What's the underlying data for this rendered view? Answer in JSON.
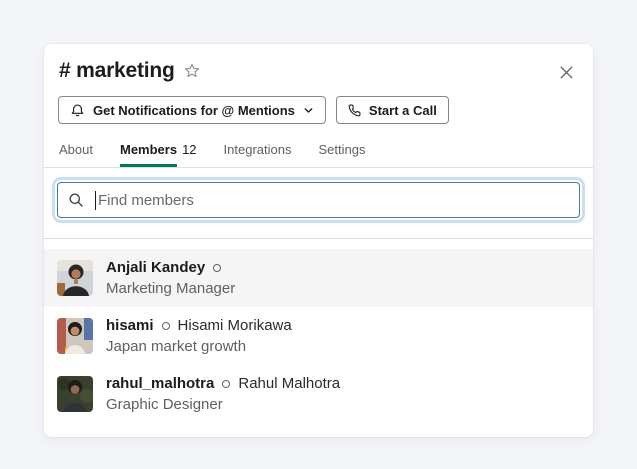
{
  "modal": {
    "title": "# marketing"
  },
  "actions": {
    "notifications_label": "Get Notifications for @ Mentions",
    "start_call_label": "Start a Call"
  },
  "tabs": [
    {
      "label": "About",
      "active": false
    },
    {
      "label": "Members",
      "count": "12",
      "active": true
    },
    {
      "label": "Integrations",
      "active": false
    },
    {
      "label": "Settings",
      "active": false
    }
  ],
  "search": {
    "placeholder": "Find members",
    "value": ""
  },
  "members": [
    {
      "display_name": "Anjali Kandey",
      "full_name": "",
      "subtitle": "Marketing Manager",
      "presence": "offline",
      "highlighted": true
    },
    {
      "display_name": "hisami",
      "full_name": "Hisami Morikawa",
      "subtitle": "Japan market growth",
      "presence": "offline",
      "highlighted": false
    },
    {
      "display_name": "rahul_malhotra",
      "full_name": "Rahul Malhotra",
      "subtitle": "Graphic Designer",
      "presence": "offline",
      "highlighted": false
    }
  ],
  "icons": {
    "star": "☆",
    "close": "✕",
    "bell": "bell-outline",
    "chevron_down": "⌄",
    "phone": "phone-outline",
    "search": "⌕",
    "presence_offline": "○"
  },
  "colors": {
    "accent_green": "#007a5a",
    "focus_border_blue": "#4a79a8",
    "focus_ring_blue": "#c9e0f1",
    "text_primary": "#1d1c1d",
    "text_secondary": "#616061",
    "row_highlight": "#f5f5f5",
    "page_background": "#f4f5f8"
  }
}
